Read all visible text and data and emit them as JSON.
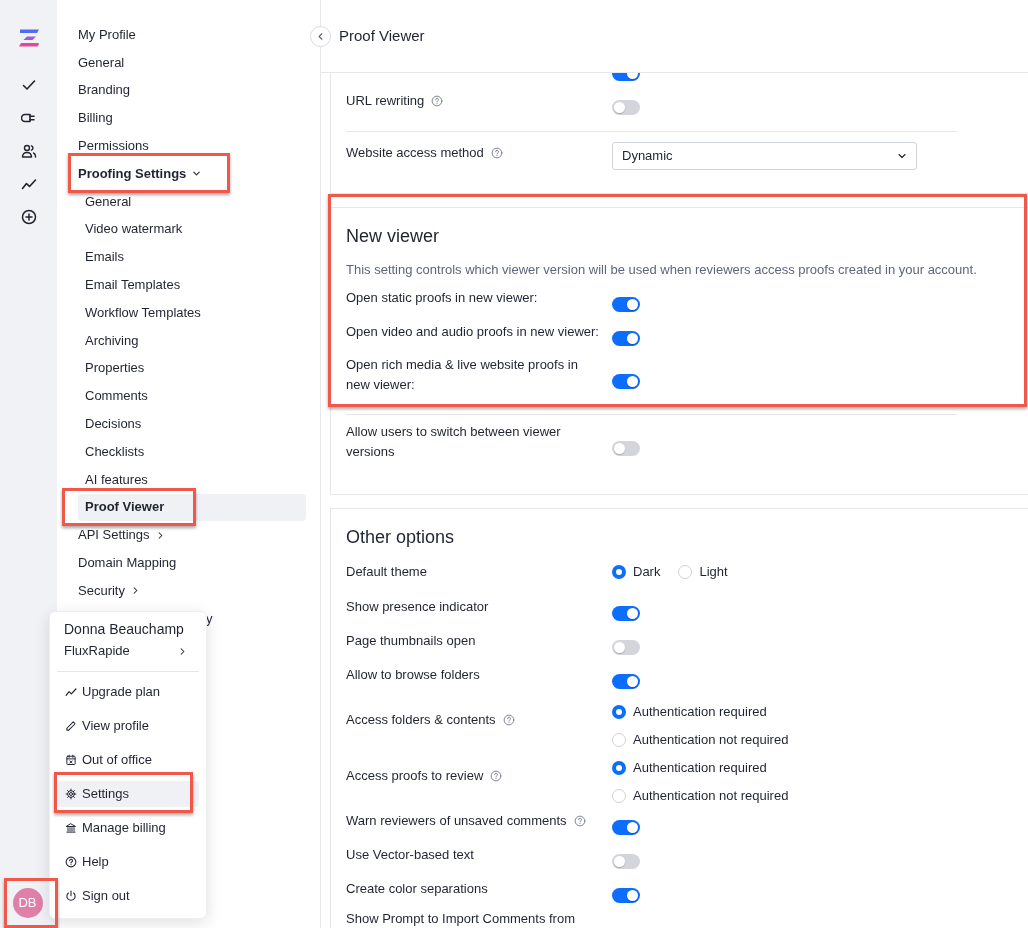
{
  "rail": {
    "avatar": {
      "initials": "DB",
      "highlighted": true
    }
  },
  "sidebar": {
    "items": [
      {
        "label": "My Profile",
        "kind": "link",
        "selected": false,
        "highlighted": false
      },
      {
        "label": "General",
        "kind": "link",
        "selected": false,
        "highlighted": false
      },
      {
        "label": "Branding",
        "kind": "link",
        "selected": false,
        "highlighted": false
      },
      {
        "label": "Billing",
        "kind": "link",
        "selected": false,
        "highlighted": false
      },
      {
        "label": "Permissions",
        "kind": "link",
        "selected": false,
        "highlighted": false
      },
      {
        "label": "Proofing Settings",
        "kind": "group",
        "expanded": true,
        "selected": false,
        "highlighted": true,
        "children": [
          {
            "label": "General",
            "kind": "link",
            "selected": false,
            "highlighted": false
          },
          {
            "label": "Video watermark",
            "kind": "link",
            "selected": false,
            "highlighted": false
          },
          {
            "label": "Emails",
            "kind": "link",
            "selected": false,
            "highlighted": false
          },
          {
            "label": "Email Templates",
            "kind": "link",
            "selected": false,
            "highlighted": false
          },
          {
            "label": "Workflow Templates",
            "kind": "link",
            "selected": false,
            "highlighted": false
          },
          {
            "label": "Archiving",
            "kind": "link",
            "selected": false,
            "highlighted": false
          },
          {
            "label": "Properties",
            "kind": "link",
            "selected": false,
            "highlighted": false
          },
          {
            "label": "Comments",
            "kind": "link",
            "selected": false,
            "highlighted": false
          },
          {
            "label": "Decisions",
            "kind": "link",
            "selected": false,
            "highlighted": false
          },
          {
            "label": "Checklists",
            "kind": "link",
            "selected": false,
            "highlighted": false
          },
          {
            "label": "AI features",
            "kind": "link",
            "selected": false,
            "highlighted": false
          },
          {
            "label": "Proof Viewer",
            "kind": "link",
            "selected": true,
            "highlighted": true
          }
        ]
      },
      {
        "label": "API Settings",
        "kind": "group",
        "expanded": false,
        "selected": false,
        "highlighted": false
      },
      {
        "label": "Domain Mapping",
        "kind": "link",
        "selected": false,
        "highlighted": false
      },
      {
        "label": "Security",
        "kind": "group",
        "expanded": false,
        "selected": false,
        "highlighted": false
      },
      {
        "label": "y",
        "kind": "covered",
        "selected": false,
        "highlighted": false
      }
    ]
  },
  "header": {
    "title": "Proof Viewer"
  },
  "cards": [
    {
      "groups": [
        {
          "rows": [
            {
              "kind": "toggle",
              "on": true
            },
            {
              "kind": "toggle",
              "label": "URL rewriting",
              "help": true,
              "on": false
            },
            {
              "kind": "divider"
            },
            {
              "kind": "select",
              "label": "Website access method",
              "help": true,
              "value": "Dynamic"
            }
          ]
        }
      ]
    },
    {
      "groups": [
        {
          "highlighted": true,
          "title": "New viewer",
          "description": "This setting controls which viewer version will be used when reviewers access proofs created in your account.",
          "rows": [
            {
              "kind": "toggle",
              "label": "Open static proofs in new viewer:",
              "on": true
            },
            {
              "kind": "toggle",
              "label": "Open video and audio proofs in new viewer:",
              "on": true
            },
            {
              "kind": "toggle",
              "label": "Open rich media & live website proofs in new viewer:",
              "on": true
            }
          ]
        },
        {
          "rows": [
            {
              "kind": "divider"
            },
            {
              "kind": "toggle",
              "label": "Allow users to switch between viewer versions",
              "on": false
            }
          ]
        }
      ]
    },
    {
      "groups": [
        {
          "title": "Other options",
          "rows": [
            {
              "kind": "inline_radio",
              "label": "Default theme",
              "options": [
                {
                  "label": "Dark",
                  "selected": true
                },
                {
                  "label": "Light",
                  "selected": false
                }
              ]
            },
            {
              "kind": "toggle",
              "label": "Show presence indicator",
              "on": true
            },
            {
              "kind": "toggle",
              "label": "Page thumbnails open",
              "on": false
            },
            {
              "kind": "toggle",
              "label": "Allow to browse folders",
              "on": true
            },
            {
              "kind": "radio",
              "label": "Access folders & contents",
              "help": true,
              "options": [
                {
                  "label": "Authentication required",
                  "selected": true
                },
                {
                  "label": "Authentication not required",
                  "selected": false
                }
              ]
            },
            {
              "kind": "radio",
              "label": "Access proofs to review",
              "help": true,
              "options": [
                {
                  "label": "Authentication required",
                  "selected": true
                },
                {
                  "label": "Authentication not required",
                  "selected": false
                }
              ]
            },
            {
              "kind": "toggle",
              "label": "Warn reviewers of unsaved comments",
              "help": true,
              "on": true
            },
            {
              "kind": "toggle",
              "label": "Use Vector-based text",
              "on": false
            },
            {
              "kind": "toggle",
              "label": "Create color separations",
              "on": true
            },
            {
              "kind": "label",
              "label": "Show Prompt to Import Comments from"
            }
          ]
        }
      ]
    }
  ],
  "user_menu": {
    "name": "Donna Beauchamp",
    "account": "FluxRapide",
    "items": [
      {
        "label": "Upgrade plan",
        "selected": false,
        "highlighted": false
      },
      {
        "label": "View profile",
        "selected": false,
        "highlighted": false
      },
      {
        "label": "Out of office",
        "selected": false,
        "highlighted": false
      },
      {
        "label": "Settings",
        "selected": true,
        "highlighted": true
      },
      {
        "label": "Manage billing",
        "selected": false,
        "highlighted": false
      },
      {
        "label": "Help",
        "selected": false,
        "highlighted": false
      },
      {
        "label": "Sign out",
        "selected": false,
        "highlighted": false
      }
    ]
  }
}
